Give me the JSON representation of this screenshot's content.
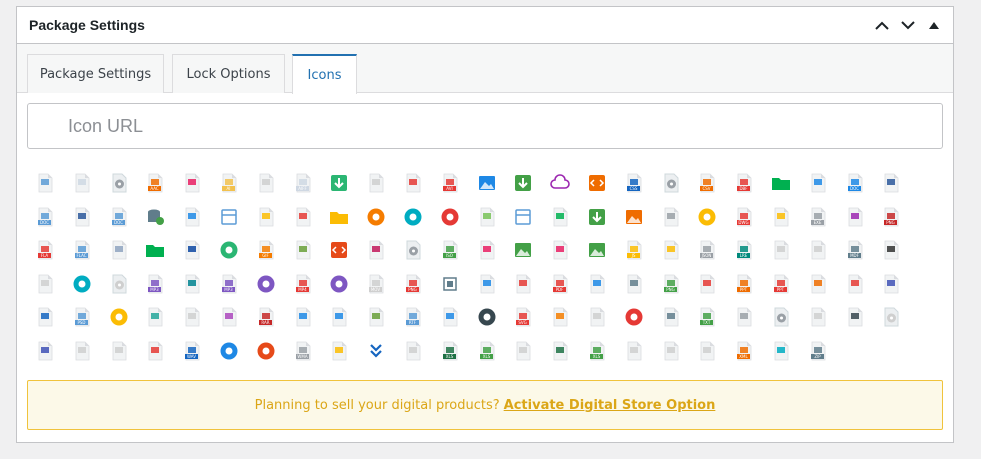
{
  "postbox": {
    "title": "Package Settings"
  },
  "tabs": [
    {
      "label": "Package Settings",
      "active": false
    },
    {
      "label": "Lock Options",
      "active": false
    },
    {
      "label": "Icons",
      "active": true
    }
  ],
  "icon_url": {
    "placeholder": "Icon URL",
    "value": ""
  },
  "colors": {
    "accent": "#2271b1",
    "notice_border": "#f0c33c",
    "notice_text": "#dba617",
    "notice_bg": "#fcf9e8"
  },
  "icon_labels": [
    [
      "",
      "",
      "",
      "AAC",
      "",
      "AI",
      "",
      "AIFF",
      "",
      "",
      "",
      "AVI",
      "",
      "",
      "",
      "",
      "CSS",
      "",
      "CSV",
      "DBF",
      "",
      "",
      "DOC",
      ""
    ],
    [
      "DOC",
      "",
      "DOC",
      "",
      "",
      "",
      "",
      "",
      "",
      "",
      "",
      "",
      "",
      "",
      "",
      "",
      "",
      "",
      "",
      "DWG",
      "",
      "EXE",
      "",
      "PNG",
      ""
    ],
    [
      "FLA",
      "FLAC",
      "",
      "",
      "",
      "",
      "GIF",
      "",
      "HTML",
      "",
      "",
      "ISO",
      "",
      "JPG",
      "",
      "",
      "JS",
      "",
      "JSON",
      "LRE",
      "",
      "",
      "MDF",
      ""
    ],
    [
      "",
      "",
      "",
      "MP3",
      "",
      "MP3",
      "",
      "MP4",
      "",
      "MOV",
      "PNG",
      "",
      "",
      "",
      "PDF",
      "",
      "",
      "PNG",
      "",
      "PPT",
      "PPT",
      "",
      "",
      ""
    ],
    [
      "",
      "PSD",
      "",
      "",
      "",
      "",
      "RAR",
      "",
      "",
      "",
      "RTF",
      "",
      "",
      "SVG",
      "",
      "",
      "TIFF",
      "",
      "TXT",
      "",
      "WAV",
      "",
      "",
      ""
    ],
    [
      "",
      "",
      "",
      "",
      "WAV",
      "",
      "",
      "WMA",
      "",
      "",
      "",
      "XLS",
      "XLS",
      "",
      "",
      "XLS",
      "",
      "",
      "",
      "XML",
      "",
      "ZIP",
      "",
      ""
    ]
  ],
  "notice": {
    "text": "Planning to sell your digital products?",
    "link": "Activate Digital Store Option"
  }
}
